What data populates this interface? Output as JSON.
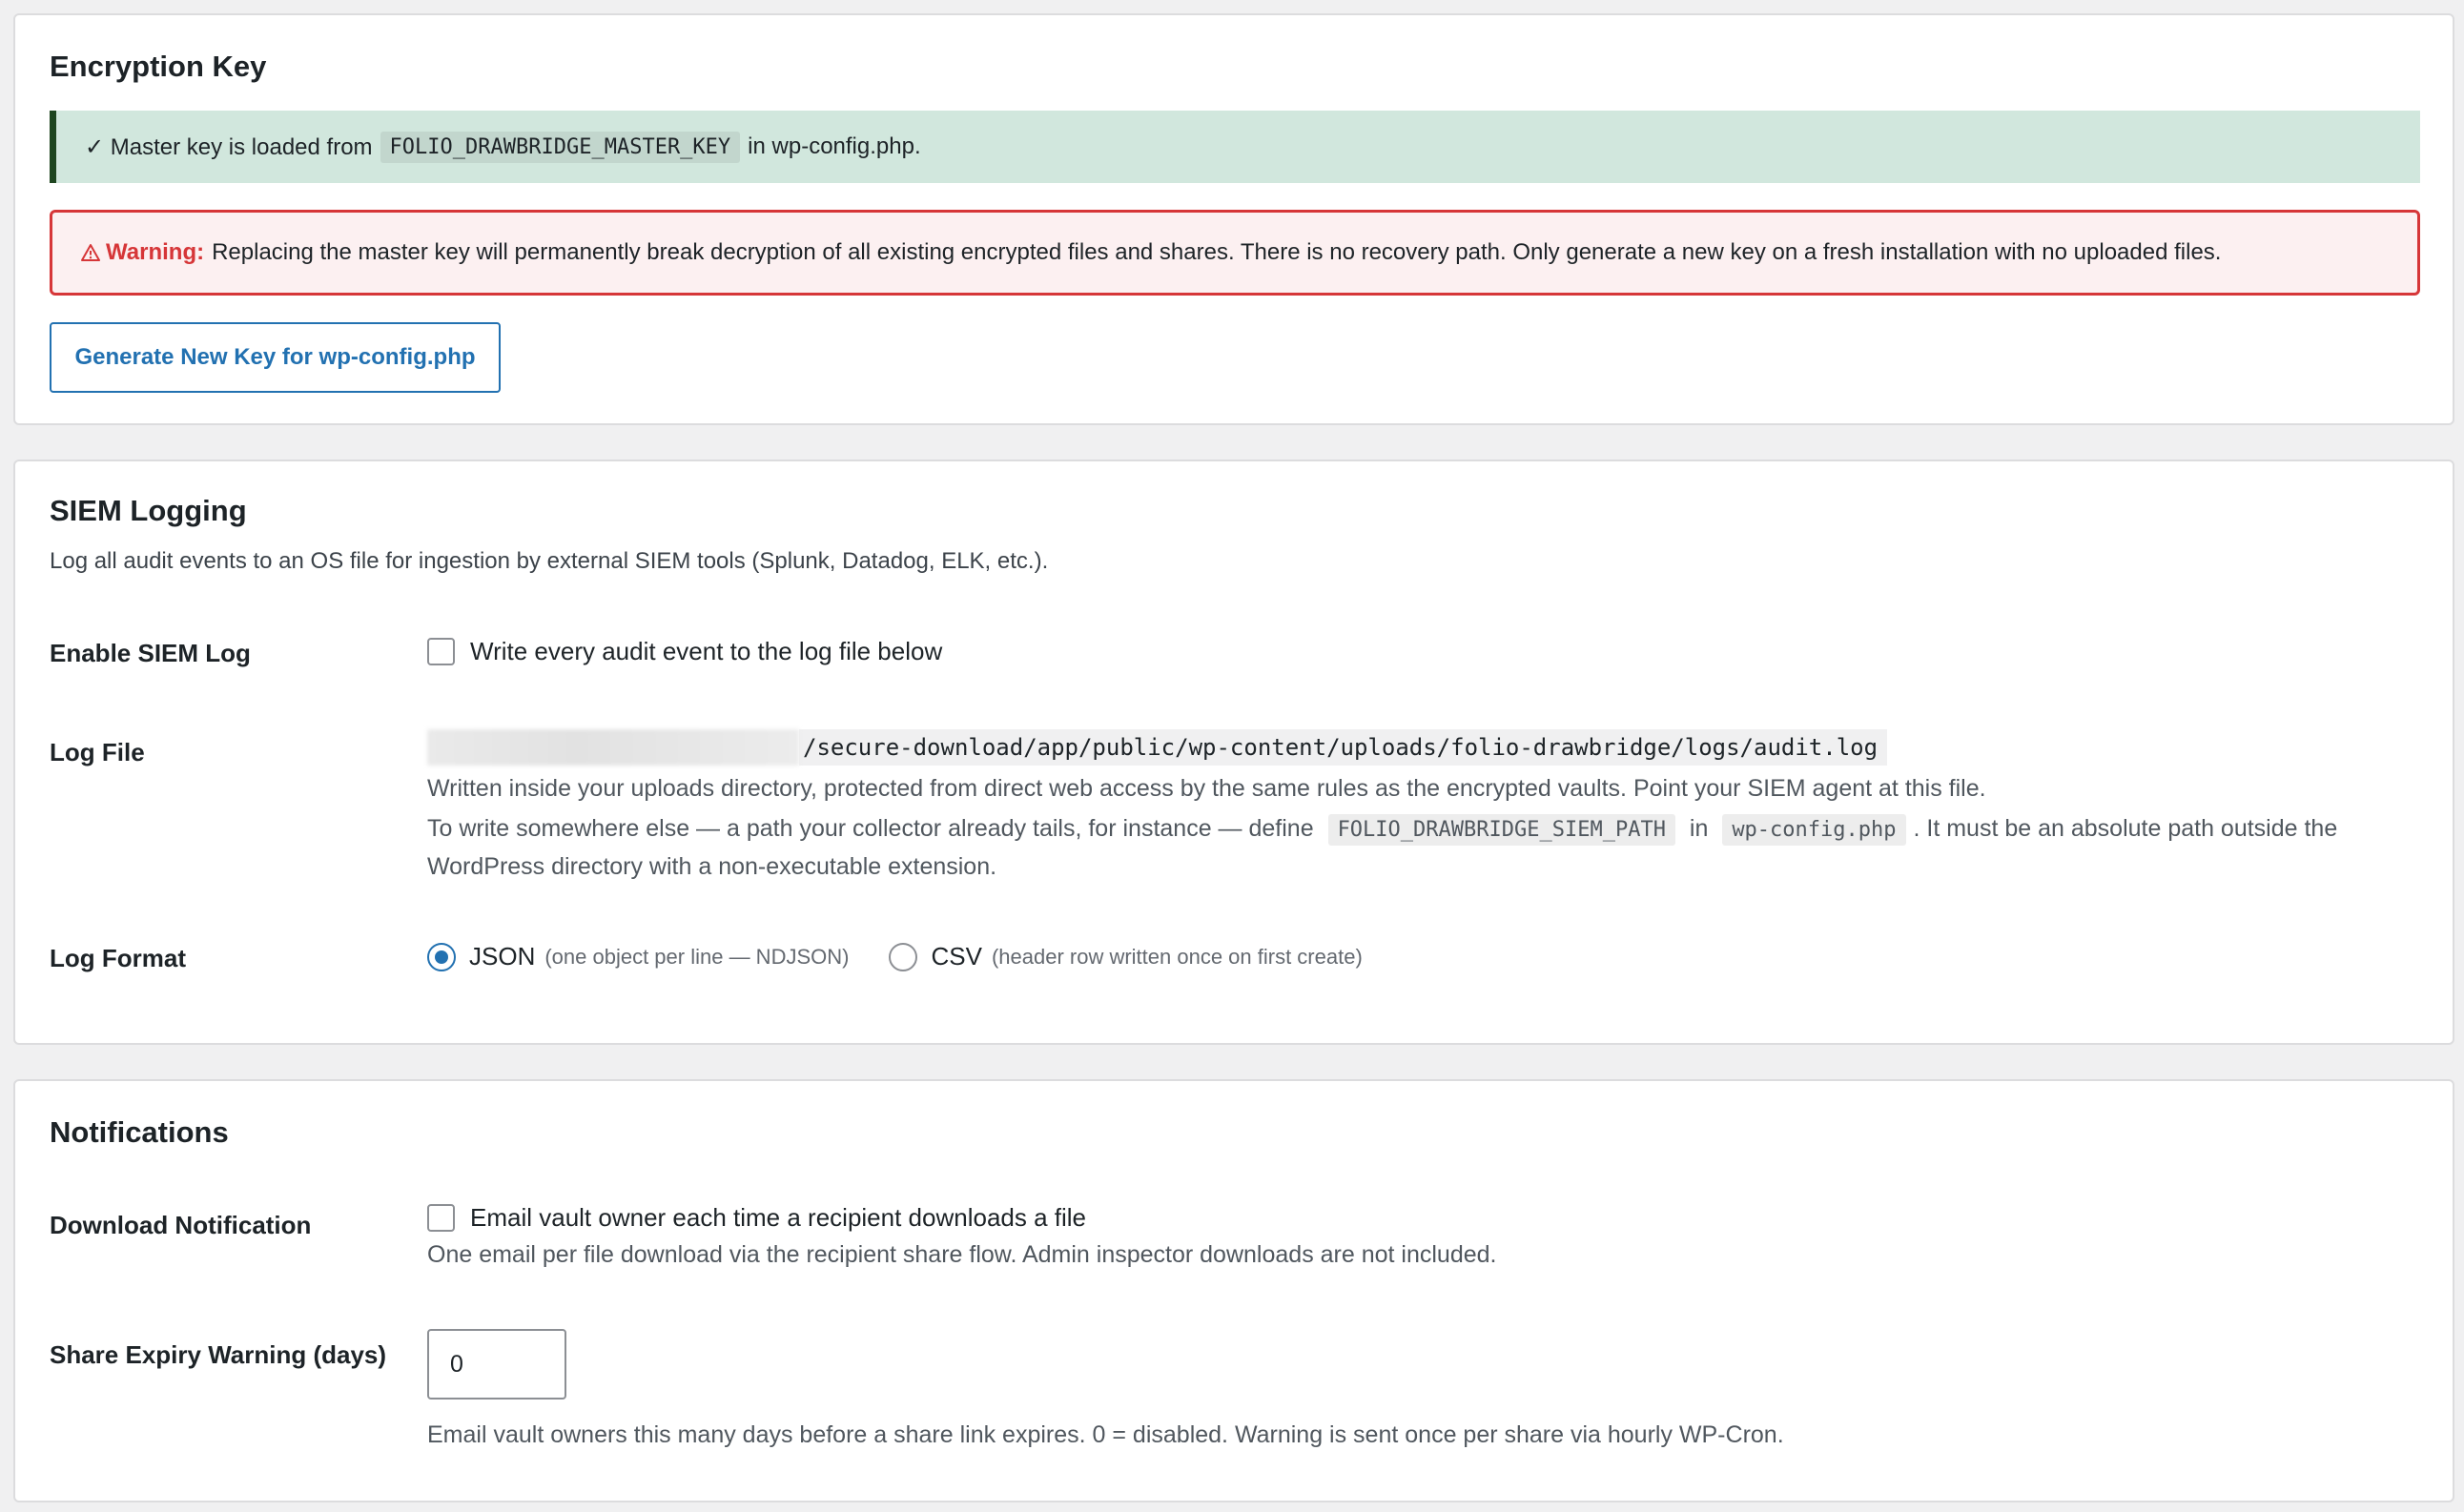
{
  "encryption": {
    "title": "Encryption Key",
    "success_prefix": "✓ Master key is loaded from",
    "success_code": "FOLIO_DRAWBRIDGE_MASTER_KEY",
    "success_suffix": "in wp-config.php.",
    "warning_label": "Warning:",
    "warning_text": "Replacing the master key will permanently break decryption of all existing encrypted files and shares. There is no recovery path. Only generate a new key on a fresh installation with no uploaded files.",
    "generate_button": "Generate New Key for wp-config.php",
    "colors": {
      "success_bg": "#d1e7dd",
      "error_border": "#d63638",
      "accent": "#2271b1"
    }
  },
  "siem": {
    "title": "SIEM Logging",
    "description": "Log all audit events to an OS file for ingestion by external SIEM tools (Splunk, Datadog, ELK, etc.).",
    "enable": {
      "label": "Enable SIEM Log",
      "checkbox_label": "Write every audit event to the log file below",
      "checked": false
    },
    "log_file": {
      "label": "Log File",
      "path": "/secure-download/app/public/wp-content/uploads/folio-drawbridge/logs/audit.log",
      "help1": "Written inside your uploads directory, protected from direct web access by the same rules as the encrypted vaults. Point your SIEM agent at this file.",
      "help2_prefix": "To write somewhere else — a path your collector already tails, for instance — define",
      "help2_code1": "FOLIO_DRAWBRIDGE_SIEM_PATH",
      "help2_mid": "in",
      "help2_code2": "wp-config.php",
      "help2_suffix": ". It must be an absolute path outside the",
      "help2_line2": "WordPress directory with a non-executable extension."
    },
    "log_format": {
      "label": "Log Format",
      "options": [
        {
          "label": "JSON",
          "sub": "(one object per line — NDJSON)",
          "selected": true
        },
        {
          "label": "CSV",
          "sub": "(header row written once on first create)",
          "selected": false
        }
      ]
    }
  },
  "notifications": {
    "title": "Notifications",
    "download": {
      "label": "Download Notification",
      "checkbox_label": "Email vault owner each time a recipient downloads a file",
      "checked": false,
      "help": "One email per file download via the recipient share flow. Admin inspector downloads are not included."
    },
    "expiry": {
      "label": "Share Expiry Warning (days)",
      "value": "0",
      "help": "Email vault owners this many days before a share link expires. 0 = disabled. Warning is sent once per share via hourly WP-Cron."
    }
  }
}
